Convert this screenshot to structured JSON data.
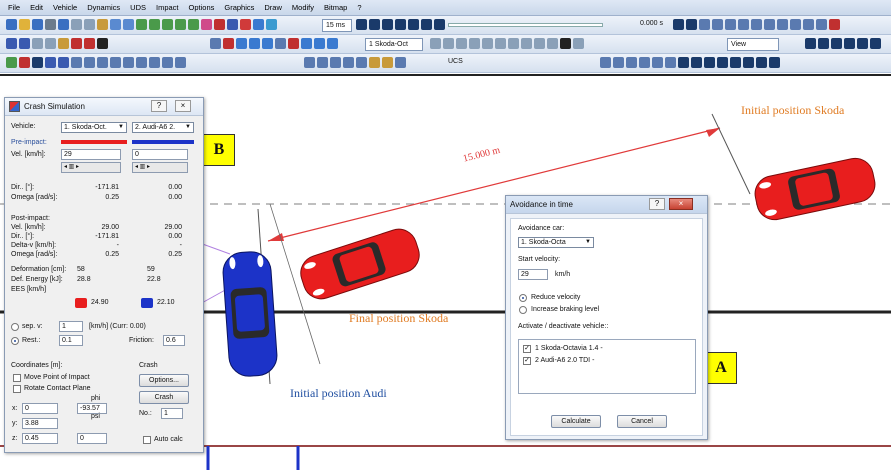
{
  "menu": [
    "File",
    "Edit",
    "Vehicle",
    "Dynamics",
    "UDS",
    "Impact",
    "Options",
    "Graphics",
    "Draw",
    "Modify",
    "Bitmap",
    "?"
  ],
  "toolbar": {
    "zoom_combo": "15 ms",
    "time_value": "0.000 s",
    "vehicle_combo": "1 Skoda-Oct",
    "view_combo": "View",
    "ucs_label": "UCS"
  },
  "scene": {
    "label_skoda_initial": "Initial position Skoda",
    "label_skoda_final": "Final position Skoda",
    "label_audi_initial": "Initial position Audi",
    "distance_label": "15.000 m",
    "marker_a": "A",
    "marker_b": "B",
    "colors": {
      "skoda": "#e81e1e",
      "audi": "#1c33c8",
      "label_orange": "#e07b22",
      "label_blue": "#1f4ea0",
      "dimension_red": "#e03a3a"
    }
  },
  "crash_sim": {
    "title": "Crash Simulation",
    "vehicle_label": "Vehicle:",
    "vehicle1": "1. Skoda-Oct.",
    "vehicle2": "2. Audi-A6 2.",
    "pre_impact": "Pre-impact:",
    "vel_label": "Vel. [km/h]:",
    "vel1": "29",
    "vel2": "0",
    "dir_label": "Dir.. [°]:",
    "dir1": "-171.81",
    "dir2": "0.00",
    "omega_label": "Omega [rad/s]:",
    "omega1": "0.25",
    "omega2": "0.00",
    "post_impact": "Post-impact:",
    "post_vel_label": "Vel. [km/h]:",
    "post_vel1": "29.00",
    "post_vel2": "29.00",
    "post_dir_label": "Dir.. [°]:",
    "post_dir1": "-171.81",
    "post_dir2": "0.00",
    "delta_v_label": "Delta-v [km/h]:",
    "delta_v1": "-",
    "delta_v2": "-",
    "post_omega_label": "Omega [rad/s]:",
    "post_omega1": "0.25",
    "post_omega2": "0.25",
    "deformation_label": "Deformation [cm]:",
    "deformation1": "58",
    "deformation2": "59",
    "def_energy_label": "Def. Energy [kJ]:",
    "def_energy1": "28.8",
    "def_energy2": "22.8",
    "ees_label": "EES [km/h]",
    "ees1": "24.90",
    "ees2": "22.10",
    "sep_v_label": "sep. v:",
    "sep_v_value": "1",
    "curr_label": "[km/h] (Curr: 0.00)",
    "rest_label": "Rest.:",
    "rest_value": "0.1",
    "friction_label": "Friction:",
    "friction_value": "0.6",
    "coords_label": "Coordinates [m]:",
    "move_poi_label": "Move Point of Impact",
    "rotate_cp_label": "Rotate Contact Plane",
    "crash_group_label": "Crash",
    "options_btn": "Options...",
    "crash_btn": "Crash",
    "phi_label": "phi",
    "psi_label": "psi",
    "x_label": "x:",
    "x_value": "0",
    "y_label": "y:",
    "y_value": "3.88",
    "z_label": "z:",
    "z_value": "0.45",
    "phi_value": "-93.57",
    "psi_value": "0",
    "no_label": "No.:",
    "no_value": "1",
    "auto_calc_label": "Auto calc"
  },
  "avoid": {
    "title": "Avoidance in time",
    "avoidance_car_label": "Avoidance car:",
    "avoidance_car": "1. Skoda-Octa",
    "start_velocity_label": "Start velocity:",
    "start_velocity": "29",
    "unit": "km/h",
    "reduce_velocity": "Reduce velocity",
    "increase_braking": "Increase braking level",
    "activate_label": "Activate / deactivate vehicle::",
    "vehicles": [
      "1  Skoda-Octavia 1.4 -",
      "2  Audi-A6 2.0 TDI -"
    ],
    "calculate_btn": "Calculate",
    "cancel_btn": "Cancel"
  }
}
